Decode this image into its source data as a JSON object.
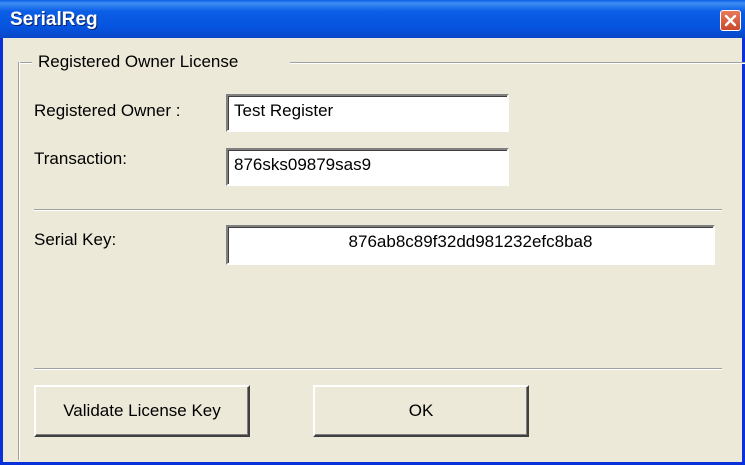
{
  "window": {
    "title": "SerialReg",
    "close_icon": "close-icon",
    "accent_color": "#0b5ee6"
  },
  "group": {
    "legend": "Registered Owner License"
  },
  "fields": {
    "owner_label": "Registered Owner :",
    "owner_value": "Test Register",
    "transaction_label": "Transaction:",
    "transaction_value": "876sks09879sas9",
    "serial_label": "Serial Key:",
    "serial_value": "876ab8c89f32dd981232efc8ba8"
  },
  "buttons": {
    "validate_label": "Validate License Key",
    "ok_label": "OK"
  }
}
